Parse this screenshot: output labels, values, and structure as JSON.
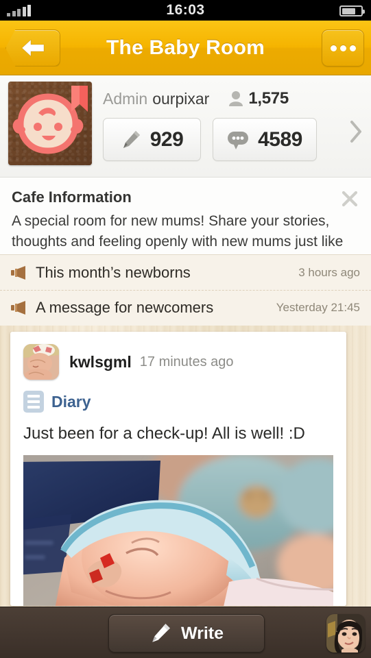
{
  "status_bar": {
    "time": "16:03",
    "signal_icon": "signal-bars-icon",
    "battery_icon": "battery-icon"
  },
  "nav_bar": {
    "title": "The Baby Room",
    "back_icon": "back-arrow-icon",
    "more_icon": "more-dots-icon",
    "background_color": "#f5b400"
  },
  "cafe_header": {
    "cafe_icon": "baby-face-cafe-icon",
    "admin_label": "Admin",
    "admin_name": "ourpixar",
    "member_icon": "person-icon",
    "member_count": "1,575",
    "posts": {
      "icon": "pencil-icon",
      "value": "929"
    },
    "comments": {
      "icon": "speech-bubble-icon",
      "value": "4589"
    },
    "chevron_icon": "chevron-right-icon"
  },
  "cafe_info": {
    "title": "Cafe Information",
    "description": "A special room for new mums! Share your stories, thoughts and feeling openly with new mums just like you!",
    "close_icon": "close-x-icon"
  },
  "notices": [
    {
      "icon": "megaphone-icon",
      "title": "This month’s newborns",
      "time": "3 hours ago"
    },
    {
      "icon": "megaphone-icon",
      "title": "A message for newcomers",
      "time": "Yesterday 21:45"
    }
  ],
  "post": {
    "avatar": "sleeping-baby-avatar",
    "author": "kwlsgml",
    "time": "17 minutes ago",
    "board_icon": "board-list-icon",
    "board_name": "Diary",
    "board_color": "#3d6290",
    "text": "Just been for a check-up! All is well! :D",
    "photo": "sleeping-newborn-photo"
  },
  "toolbar": {
    "write_icon": "pencil-icon",
    "write_label": "Write",
    "profile_icon": "user-profile-avatar"
  }
}
